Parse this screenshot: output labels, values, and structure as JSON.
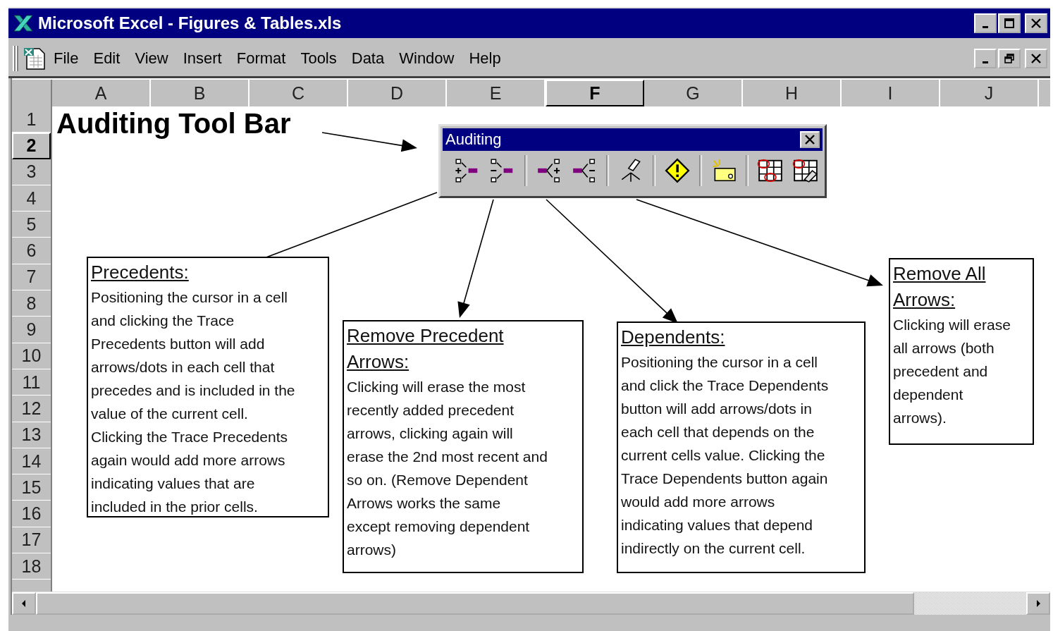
{
  "window": {
    "title": "Microsoft Excel - Figures & Tables.xls"
  },
  "menu": [
    {
      "label": "File"
    },
    {
      "label": "Edit"
    },
    {
      "label": "View"
    },
    {
      "label": "Insert"
    },
    {
      "label": "Format"
    },
    {
      "label": "Tools"
    },
    {
      "label": "Data"
    },
    {
      "label": "Window"
    },
    {
      "label": "Help"
    }
  ],
  "columns": [
    {
      "label": "A",
      "selected": false
    },
    {
      "label": "B",
      "selected": false
    },
    {
      "label": "C",
      "selected": false
    },
    {
      "label": "D",
      "selected": false
    },
    {
      "label": "E",
      "selected": false
    },
    {
      "label": "F",
      "selected": true
    },
    {
      "label": "G",
      "selected": false
    },
    {
      "label": "H",
      "selected": false
    },
    {
      "label": "I",
      "selected": false
    },
    {
      "label": "J",
      "selected": false
    }
  ],
  "rows": [
    {
      "label": "1",
      "selected": false
    },
    {
      "label": "2",
      "selected": true
    },
    {
      "label": "3",
      "selected": false
    },
    {
      "label": "4",
      "selected": false
    },
    {
      "label": "5",
      "selected": false
    },
    {
      "label": "6",
      "selected": false
    },
    {
      "label": "7",
      "selected": false
    },
    {
      "label": "8",
      "selected": false
    },
    {
      "label": "9",
      "selected": false
    },
    {
      "label": "10",
      "selected": false
    },
    {
      "label": "11",
      "selected": false
    },
    {
      "label": "12",
      "selected": false
    },
    {
      "label": "13",
      "selected": false
    },
    {
      "label": "14",
      "selected": false
    },
    {
      "label": "15",
      "selected": false
    },
    {
      "label": "16",
      "selected": false
    },
    {
      "label": "17",
      "selected": false
    },
    {
      "label": "18",
      "selected": false
    }
  ],
  "sheet": {
    "title": "Auditing Tool Bar",
    "toolbar": {
      "title": "Auditing"
    },
    "notes": [
      {
        "heading": [
          "Precedents:"
        ],
        "body": [
          "Positioning the cursor in a cell",
          "and clicking the Trace",
          "Precedents button will add",
          "arrows/dots in each cell that",
          "precedes and is included in the",
          "value of the current cell.",
          "Clicking the Trace Precedents",
          "again would add more arrows",
          "indicating values that are",
          "included in the prior cells."
        ]
      },
      {
        "heading": [
          "Remove Precedent",
          "Arrows:"
        ],
        "body": [
          "Clicking will erase the most",
          "recently added precedent",
          "arrows, clicking again will",
          "erase the 2nd most recent and",
          "so on.  (Remove Dependent",
          "Arrows works the same",
          "except removing dependent",
          "arrows)"
        ]
      },
      {
        "heading": [
          "Dependents:"
        ],
        "body": [
          "Positioning the cursor in a cell",
          "and click the Trace Dependents",
          "button will add arrows/dots in",
          "each cell that depends on the",
          "current cells value.  Clicking the",
          "Trace Dependents button again",
          "would add more arrows",
          "indicating values that depend",
          "indirectly on the current cell."
        ]
      },
      {
        "heading": [
          "Remove All",
          "Arrows:"
        ],
        "body": [
          "Clicking will erase",
          "all arrows (both",
          "precedent and",
          "dependent",
          "arrows)."
        ]
      }
    ]
  }
}
